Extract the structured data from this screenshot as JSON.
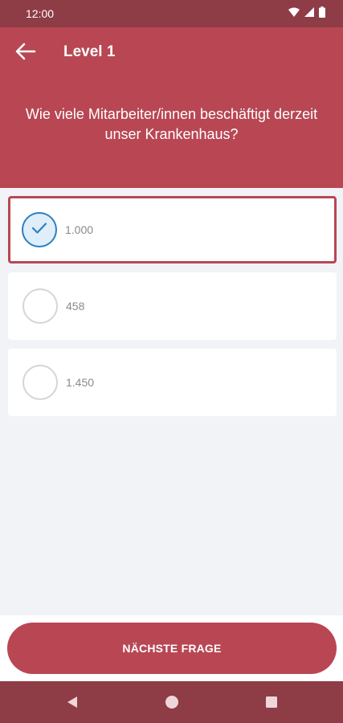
{
  "status_bar": {
    "time": "12:00",
    "icons": [
      "wifi-icon",
      "signal-icon",
      "battery-icon"
    ]
  },
  "header": {
    "title": "Level 1",
    "back_icon": "arrow-left-icon"
  },
  "question": "Wie viele Mitarbeiter/innen beschäftigt derzeit unser Krankenhaus?",
  "options": [
    {
      "label": "1.000",
      "selected": true
    },
    {
      "label": "458",
      "selected": false
    },
    {
      "label": "1.450",
      "selected": false
    }
  ],
  "next_button": {
    "label": "NÄCHSTE FRAGE"
  },
  "nav_bar": {
    "icons": [
      "back-triangle-icon",
      "home-circle-icon",
      "recents-square-icon"
    ]
  },
  "colors": {
    "primary": "#b84753",
    "status_bar": "#8e3c46",
    "selected_check": "#2d7fc1",
    "background": "#f1f3f7"
  }
}
